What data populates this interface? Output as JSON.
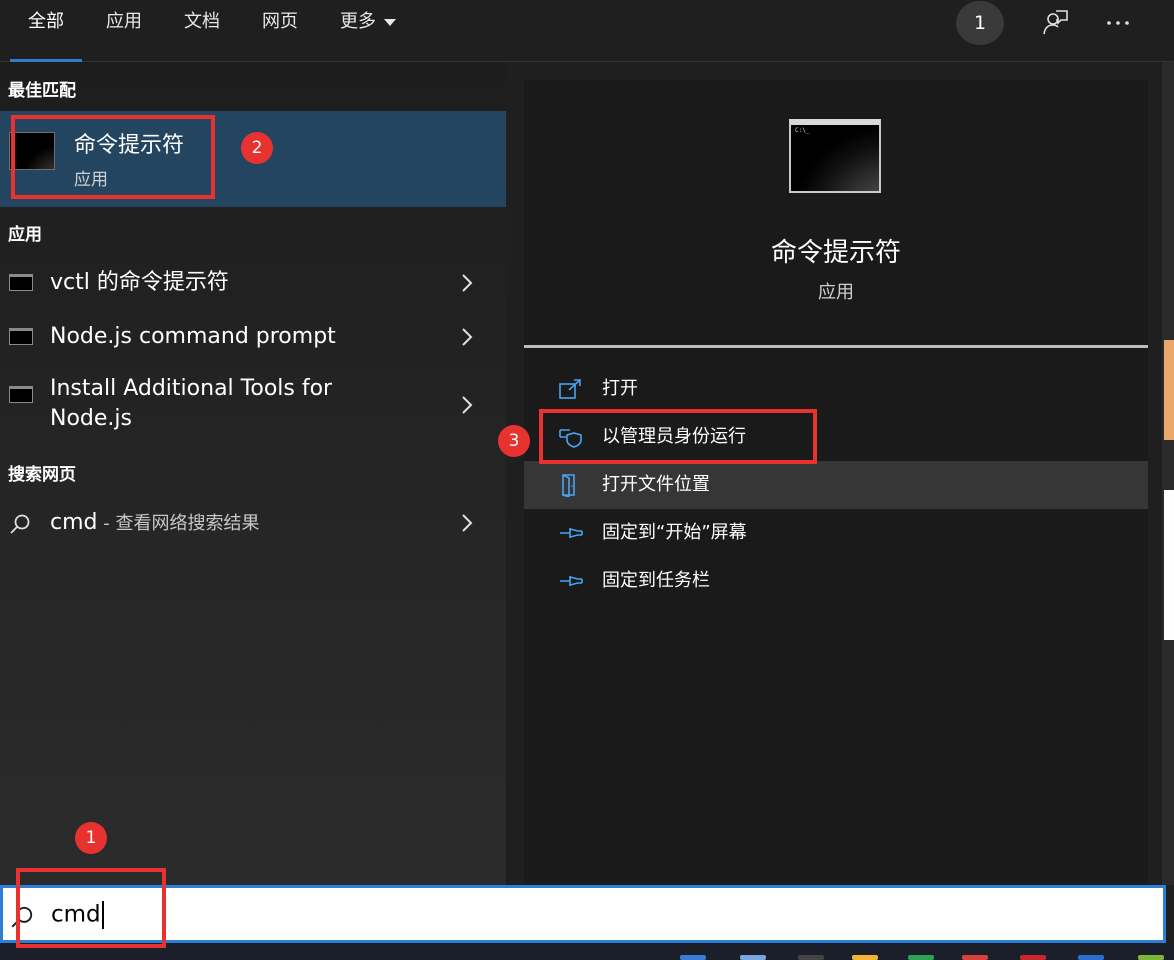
{
  "tabs": [
    {
      "label": "全部",
      "active": true
    },
    {
      "label": "应用"
    },
    {
      "label": "文档"
    },
    {
      "label": "网页"
    },
    {
      "label": "更多"
    }
  ],
  "topbar": {
    "badge_count": "1"
  },
  "left": {
    "best_match_heading": "最佳匹配",
    "best_match": {
      "title": "命令提示符",
      "subtitle": "应用"
    },
    "apps_heading": "应用",
    "apps": [
      {
        "label": "vctl 的命令提示符"
      },
      {
        "label": "Node.js command prompt"
      },
      {
        "label_line1": "Install Additional Tools for",
        "label_line2": "Node.js"
      }
    ],
    "web_heading": "搜索网页",
    "web_result": {
      "query": "cmd",
      "suffix": " - 查看网络搜索结果"
    }
  },
  "detail": {
    "title": "命令提示符",
    "subtitle": "应用",
    "thumb_text": "C:\\_",
    "actions": [
      {
        "label": "打开",
        "icon": "open-icon"
      },
      {
        "label": "以管理员身份运行",
        "icon": "shield-icon"
      },
      {
        "label": "打开文件位置",
        "icon": "file-location-icon"
      },
      {
        "label": "固定到“开始”屏幕",
        "icon": "pin-icon"
      },
      {
        "label": "固定到任务栏",
        "icon": "pin-icon"
      }
    ]
  },
  "search": {
    "value": "cmd"
  },
  "annotations": [
    "1",
    "2",
    "3"
  ],
  "colors": {
    "accent": "#2d7dd2",
    "selection": "#244560",
    "annotation": "#e8322f"
  }
}
